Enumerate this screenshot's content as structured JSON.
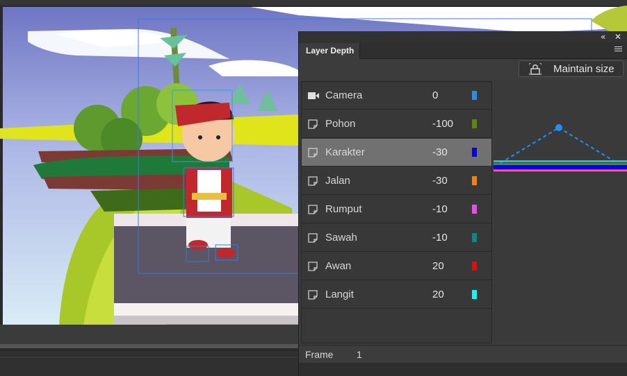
{
  "panel": {
    "collapse_glyph": "«",
    "close_glyph": "✕",
    "tab_label": "Layer Depth",
    "maintain_size_label": "Maintain size",
    "frame_label": "Frame",
    "frame_value": "1"
  },
  "layers": [
    {
      "name": "Camera",
      "depth": "0",
      "color": "#1e90ff",
      "icon": "camera-icon"
    },
    {
      "name": "Pohon",
      "depth": "-100",
      "color": "#5a8a00",
      "icon": "layer-icon"
    },
    {
      "name": "Karakter",
      "depth": "-30",
      "color": "#0000ff",
      "icon": "layer-icon",
      "selected": true
    },
    {
      "name": "Jalan",
      "depth": "-30",
      "color": "#ff8000",
      "icon": "layer-icon"
    },
    {
      "name": "Rumput",
      "depth": "-10",
      "color": "#ff40ff",
      "icon": "layer-icon"
    },
    {
      "name": "Sawah",
      "depth": "-10",
      "color": "#008b8b",
      "icon": "layer-icon"
    },
    {
      "name": "Awan",
      "depth": "20",
      "color": "#ff0000",
      "icon": "layer-icon"
    },
    {
      "name": "Langit",
      "depth": "20",
      "color": "#00ffff",
      "icon": "layer-icon"
    }
  ],
  "icons": [
    "lock-icon",
    "panel-menu-icon",
    "camera-icon",
    "layer-icon"
  ]
}
